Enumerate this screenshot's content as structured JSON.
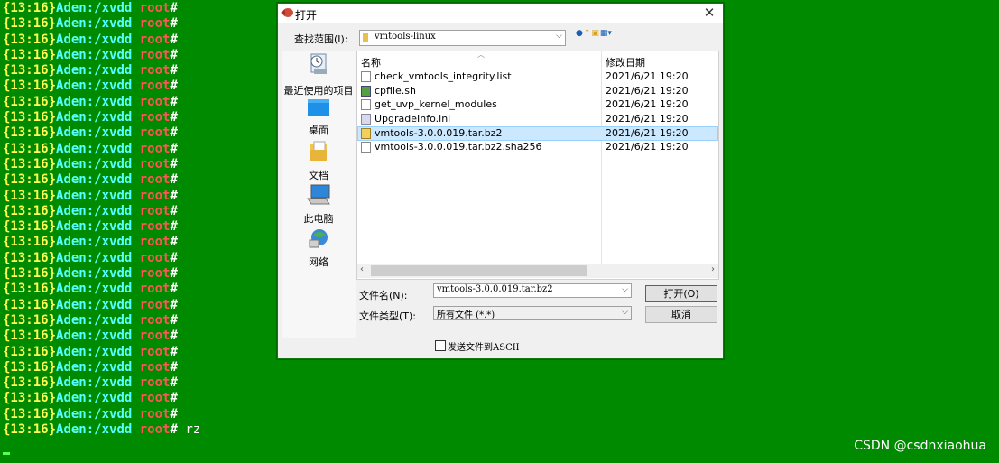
{
  "terminal": {
    "prompt_time": "{13:16}",
    "prompt_host": "Aden:/xvdd",
    "prompt_user": "root",
    "prompt_hash": "#",
    "last_command": " rz",
    "line_count": 28
  },
  "dialog": {
    "title": "打开",
    "look_in_label": "查找范围(I):",
    "look_in_value": "vmtools-linux",
    "places": [
      {
        "label": "最近使用的项目",
        "icon": "recent-icon"
      },
      {
        "label": "桌面",
        "icon": "desktop-icon"
      },
      {
        "label": "文档",
        "icon": "documents-icon"
      },
      {
        "label": "此电脑",
        "icon": "computer-icon"
      },
      {
        "label": "网络",
        "icon": "network-icon"
      }
    ],
    "columns": {
      "name": "名称",
      "date": "修改日期"
    },
    "files": [
      {
        "name": "check_vmtools_integrity.list",
        "date": "2021/6/21 19:20",
        "type": "doc"
      },
      {
        "name": "cpfile.sh",
        "date": "2021/6/21 19:20",
        "type": "sh"
      },
      {
        "name": "get_uvp_kernel_modules",
        "date": "2021/6/21 19:20",
        "type": "doc"
      },
      {
        "name": "UpgradeInfo.ini",
        "date": "2021/6/21 19:20",
        "type": "ini"
      },
      {
        "name": "vmtools-3.0.0.019.tar.bz2",
        "date": "2021/6/21 19:20",
        "type": "bz2",
        "selected": true
      },
      {
        "name": "vmtools-3.0.0.019.tar.bz2.sha256",
        "date": "2021/6/21 19:20",
        "type": "doc"
      }
    ],
    "filename_label": "文件名(N):",
    "filename_value": "vmtools-3.0.0.019.tar.bz2",
    "filetype_label": "文件类型(T):",
    "filetype_value": "所有文件 (*.*)",
    "open_button": "打开(O)",
    "cancel_button": "取消",
    "ascii_checkbox_label": "发送文件到ASCII",
    "ascii_checked": false
  },
  "watermark": "CSDN @csdnxiaohua",
  "colors": {
    "background": "#008a00",
    "prompt_time": "#ffff55",
    "prompt_host": "#55ffff",
    "prompt_user": "#ff5555",
    "selection": "#cce8ff"
  }
}
